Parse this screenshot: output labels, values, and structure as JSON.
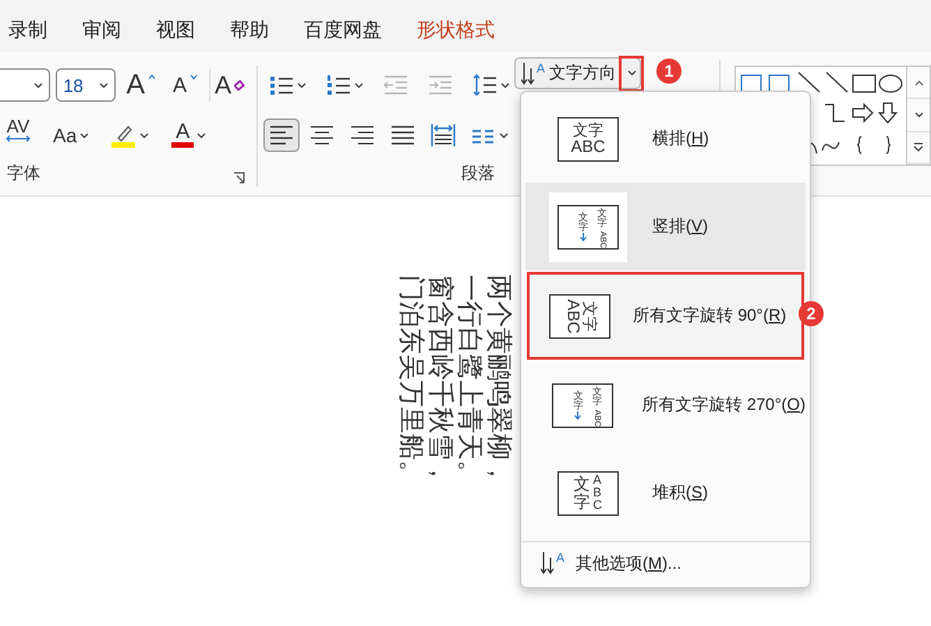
{
  "tabs": [
    {
      "label": "录制",
      "kind": "normal"
    },
    {
      "label": "审阅",
      "kind": "normal"
    },
    {
      "label": "视图",
      "kind": "normal"
    },
    {
      "label": "帮助",
      "kind": "normal"
    },
    {
      "label": "百度网盘",
      "kind": "normal"
    },
    {
      "label": "形状格式",
      "kind": "contextual"
    }
  ],
  "font_group": {
    "font_size": "18",
    "label": "字体",
    "row1": [
      {
        "kind": "grow",
        "glyph": "A"
      },
      {
        "kind": "shrink",
        "glyph": "A"
      },
      {
        "kind": "clear",
        "glyph": "A"
      }
    ],
    "row2": [
      {
        "kind": "spacing",
        "glyph": "AV"
      },
      {
        "kind": "case",
        "glyph": "Aa"
      },
      {
        "kind": "highlight"
      },
      {
        "kind": "font-color",
        "glyph": "A"
      }
    ]
  },
  "paragraph_group": {
    "label": "段落",
    "row1": [
      {
        "kind": "bullets",
        "disabled": false
      },
      {
        "kind": "numbering",
        "disabled": false
      },
      {
        "kind": "outdent",
        "disabled": true
      },
      {
        "kind": "indent",
        "disabled": true
      },
      {
        "kind": "line-spacing",
        "disabled": false
      }
    ],
    "row2": [
      {
        "kind": "align-left",
        "selected": true
      },
      {
        "kind": "align-center",
        "selected": false
      },
      {
        "kind": "align-right",
        "selected": false
      },
      {
        "kind": "justify",
        "selected": false
      },
      {
        "kind": "distribute",
        "selected": false
      },
      {
        "kind": "columns",
        "selected": false
      }
    ]
  },
  "text_direction": {
    "label": "文字方向",
    "icon_glyph": "A",
    "callout": "1"
  },
  "menu": {
    "items": [
      {
        "kind": "horizontal",
        "text": "横排(",
        "key": "H",
        "tail": ")",
        "highlighted": false,
        "preview": [
          "文字",
          "ABC"
        ]
      },
      {
        "kind": "vertical",
        "text": "竖排(",
        "key": "V",
        "tail": ")",
        "highlighted": true,
        "preview": [
          "文字",
          "文字",
          "ABC"
        ]
      },
      {
        "kind": "rotate90",
        "text": "所有文字旋转 90°(",
        "key": "R",
        "tail": ")",
        "highlighted": false,
        "callout": "2",
        "preview": [
          "文字",
          "ABC"
        ]
      },
      {
        "kind": "vertical",
        "text": "所有文字旋转 270°(",
        "key": "O",
        "tail": ")",
        "highlighted": false,
        "preview": [
          "文字",
          "文字",
          "ABC"
        ]
      },
      {
        "kind": "stacked",
        "text": "堆积(",
        "key": "S",
        "tail": ")",
        "highlighted": false,
        "preview": [
          "文字",
          "ABC"
        ]
      }
    ],
    "footer": {
      "text": "其他选项(",
      "key": "M",
      "tail": ")...",
      "icon_glyph": "A"
    }
  },
  "document": {
    "lines": [
      "两个黄鹂鸣翠柳，",
      "一行白鹭上青天。",
      "窗含西岭千秋雪，",
      "门泊东吴万里船。"
    ]
  }
}
